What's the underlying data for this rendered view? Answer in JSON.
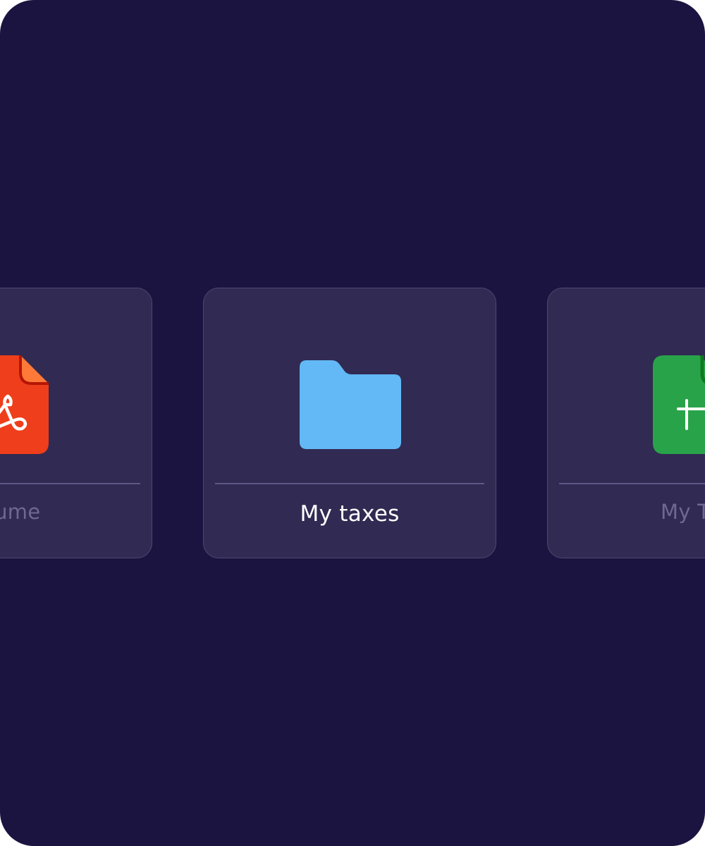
{
  "colors": {
    "background": "#1b1440",
    "card": "#312a52",
    "card_border": "#4e4773",
    "divider": "#5f5884",
    "label_active": "#ffffff",
    "label_inactive": "#6f6891",
    "pdf_red": "#ef3e1b",
    "pdf_fold": "#ff7a38",
    "folder_blue": "#62b9f5",
    "sheet_green": "#29a34a"
  },
  "cards": [
    {
      "label": "esume",
      "icon": "pdf-icon",
      "state": "inactive"
    },
    {
      "label": "My taxes",
      "icon": "folder-icon",
      "state": "active"
    },
    {
      "label": "My Ta",
      "icon": "spreadsheet-icon",
      "state": "inactive"
    }
  ]
}
